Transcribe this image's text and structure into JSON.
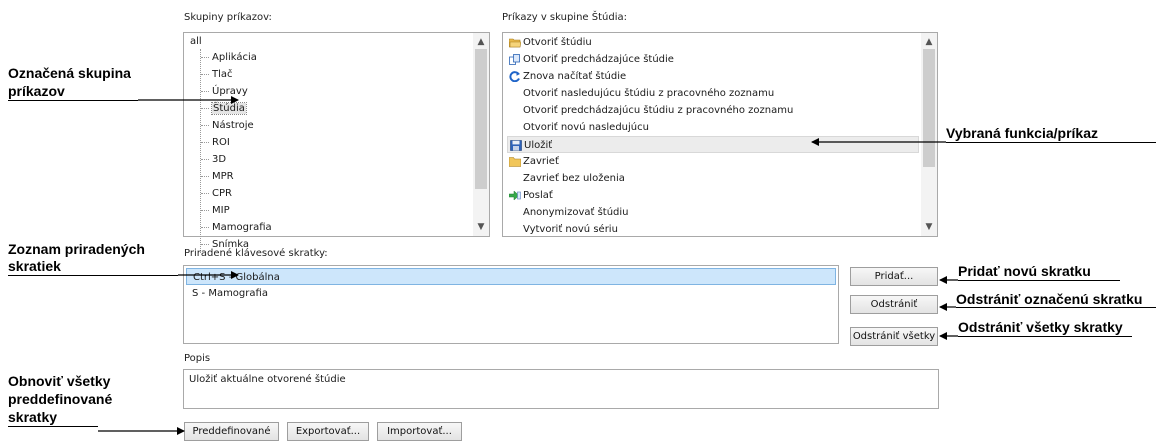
{
  "groups": {
    "label": "Skupiny príkazov:",
    "root": "all",
    "items": [
      "Aplikácia",
      "Tlač",
      "Úpravy",
      "Štúdia",
      "Nástroje",
      "ROI",
      "3D",
      "MPR",
      "CPR",
      "MIP",
      "Mamografia",
      "Snímka"
    ],
    "selected": "Štúdia"
  },
  "commands": {
    "label": "Príkazy v skupine Štúdia:",
    "items": [
      {
        "text": "Otvoriť štúdiu",
        "icon": "open-folder-icon"
      },
      {
        "text": "Otvoriť predchádzajúce štúdie",
        "icon": "copy-documents-icon"
      },
      {
        "text": "Znova načítať štúdie",
        "icon": "reload-icon"
      },
      {
        "text": "Otvoriť nasledujúcu štúdiu z pracovného zoznamu",
        "icon": ""
      },
      {
        "text": "Otvoriť predchádzajúcu štúdiu z pracovného zoznamu",
        "icon": ""
      },
      {
        "text": "Otvoriť novú nasledujúcu",
        "icon": ""
      },
      {
        "text": "Uložiť",
        "icon": "save-floppy-icon"
      },
      {
        "text": "Zavrieť",
        "icon": "folder-icon"
      },
      {
        "text": "Zavrieť bez uloženia",
        "icon": ""
      },
      {
        "text": "Poslať",
        "icon": "send-arrow-icon"
      },
      {
        "text": "Anonymizovať štúdiu",
        "icon": ""
      },
      {
        "text": "Vytvoriť novú sériu",
        "icon": ""
      }
    ],
    "selected": "Uložiť"
  },
  "shortcuts": {
    "label": "Priradené klávesové skratky:",
    "items": [
      "Ctrl+S - Globálna",
      "S - Mamografia"
    ],
    "selected": "Ctrl+S - Globálna"
  },
  "buttons": {
    "add": "Pridať...",
    "remove": "Odstrániť",
    "remove_all": "Odstrániť všetky",
    "defaults": "Preddefinované",
    "export": "Exportovať...",
    "import": "Importovať..."
  },
  "description": {
    "label": "Popis",
    "text": "Uložiť aktuálne otvorené štúdie"
  },
  "annotations": {
    "group_line1": "Označená skupina",
    "group_line2": "príkazov",
    "function": "Vybraná funkcia/príkaz",
    "shortcuts_line1": "Zoznam priradených",
    "shortcuts_line2": "skratiek",
    "add": "Pridať novú skratku",
    "remove": "Odstrániť označenú skratku",
    "remove_all": "Odstrániť všetky skratky",
    "restore_line1": "Obnoviť všetky",
    "restore_line2": "preddefinované",
    "restore_line3": "skratky"
  },
  "colors": {
    "selection": "#cde6fb",
    "annotation": "#000000"
  }
}
